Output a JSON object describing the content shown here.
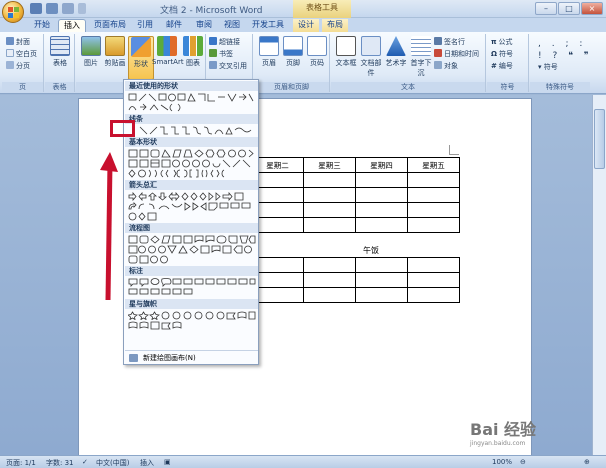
{
  "window": {
    "title": "文档 2 - Microsoft Word",
    "context_tools": "表格工具"
  },
  "tabs": [
    "开始",
    "插入",
    "页面布局",
    "引用",
    "邮件",
    "审阅",
    "视图",
    "开发工具",
    "设计",
    "布局"
  ],
  "active_tab": "插入",
  "ribbon": {
    "pages": {
      "cover": "封面",
      "blank": "空白页",
      "break": "分页",
      "label": "页"
    },
    "tables": {
      "table": "表格",
      "label": "表格"
    },
    "illustrations": {
      "picture": "图片",
      "clipart": "剪贴画",
      "shapes": "形状",
      "smartart": "SmartArt",
      "chart": "图表",
      "label": "插图"
    },
    "links": {
      "hyperlink": "超链接",
      "bookmark": "书签",
      "crossref": "交叉引用"
    },
    "header_footer": {
      "header": "页眉",
      "footer": "页脚",
      "page_number": "页码",
      "label": "页眉和页脚"
    },
    "text": {
      "textbox": "文本框",
      "quickparts": "文档部件",
      "wordart": "艺术字",
      "dropcap": "首字下沉",
      "signature": "签名行",
      "datetime": "日期和时间",
      "object": "对象",
      "label": "文本"
    },
    "symbols": {
      "formula": "公式",
      "symbol": "符号",
      "numbering": "编号",
      "label": "符号"
    },
    "special": {
      "label": "特殊符号"
    }
  },
  "shapes_menu": {
    "recent": "最近使用的形状",
    "lines": "线条",
    "basic": "基本形状",
    "arrows": "箭头总汇",
    "flowchart": "流程图",
    "callouts": "标注",
    "stars": "星与旗帜",
    "new_canvas": "新建绘图画布(N)"
  },
  "table": {
    "headers": [
      "星期二",
      "星期三",
      "星期四",
      "星期五"
    ],
    "lunch_label": "午饭"
  },
  "status": {
    "page": "页面: 1/1",
    "words": "字数: 31",
    "language": "中文(中国)",
    "mode": "插入",
    "zoom": "100%"
  },
  "watermark": {
    "brand": "Bai 经验",
    "url": "jingyan.baidu.com"
  }
}
